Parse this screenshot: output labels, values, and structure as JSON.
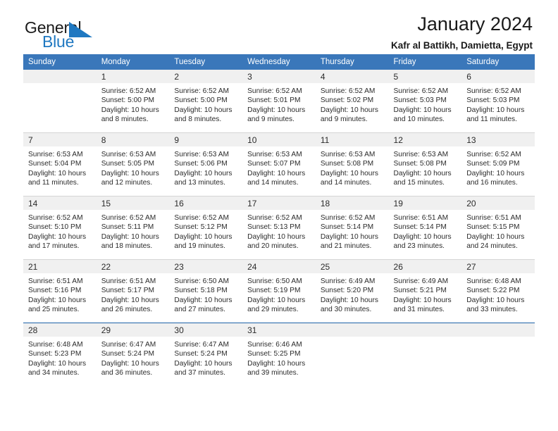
{
  "brand": {
    "name_part1": "General",
    "name_part2": "Blue",
    "accent_color": "#1f78c1"
  },
  "header": {
    "title": "January 2024",
    "subtitle": "Kafr al Battikh, Damietta, Egypt"
  },
  "theme": {
    "header_row_color": "#3a77ba",
    "daynum_band_color": "#f0f0f0",
    "week_divider_color": "#d5d5d5",
    "last_week_divider_color": "#1f63a8"
  },
  "weekday_headers": [
    "Sunday",
    "Monday",
    "Tuesday",
    "Wednesday",
    "Thursday",
    "Friday",
    "Saturday"
  ],
  "labels": {
    "sunrise_prefix": "Sunrise:",
    "sunset_prefix": "Sunset:",
    "daylight_prefix": "Daylight:"
  },
  "weeks": [
    [
      {
        "day": "",
        "sunrise": "",
        "sunset": "",
        "daylight_line1": "",
        "daylight_line2": "",
        "empty": true
      },
      {
        "day": "1",
        "sunrise": "Sunrise: 6:52 AM",
        "sunset": "Sunset: 5:00 PM",
        "daylight_line1": "Daylight: 10 hours",
        "daylight_line2": "and 8 minutes."
      },
      {
        "day": "2",
        "sunrise": "Sunrise: 6:52 AM",
        "sunset": "Sunset: 5:00 PM",
        "daylight_line1": "Daylight: 10 hours",
        "daylight_line2": "and 8 minutes."
      },
      {
        "day": "3",
        "sunrise": "Sunrise: 6:52 AM",
        "sunset": "Sunset: 5:01 PM",
        "daylight_line1": "Daylight: 10 hours",
        "daylight_line2": "and 9 minutes."
      },
      {
        "day": "4",
        "sunrise": "Sunrise: 6:52 AM",
        "sunset": "Sunset: 5:02 PM",
        "daylight_line1": "Daylight: 10 hours",
        "daylight_line2": "and 9 minutes."
      },
      {
        "day": "5",
        "sunrise": "Sunrise: 6:52 AM",
        "sunset": "Sunset: 5:03 PM",
        "daylight_line1": "Daylight: 10 hours",
        "daylight_line2": "and 10 minutes."
      },
      {
        "day": "6",
        "sunrise": "Sunrise: 6:52 AM",
        "sunset": "Sunset: 5:03 PM",
        "daylight_line1": "Daylight: 10 hours",
        "daylight_line2": "and 11 minutes."
      }
    ],
    [
      {
        "day": "7",
        "sunrise": "Sunrise: 6:53 AM",
        "sunset": "Sunset: 5:04 PM",
        "daylight_line1": "Daylight: 10 hours",
        "daylight_line2": "and 11 minutes."
      },
      {
        "day": "8",
        "sunrise": "Sunrise: 6:53 AM",
        "sunset": "Sunset: 5:05 PM",
        "daylight_line1": "Daylight: 10 hours",
        "daylight_line2": "and 12 minutes."
      },
      {
        "day": "9",
        "sunrise": "Sunrise: 6:53 AM",
        "sunset": "Sunset: 5:06 PM",
        "daylight_line1": "Daylight: 10 hours",
        "daylight_line2": "and 13 minutes."
      },
      {
        "day": "10",
        "sunrise": "Sunrise: 6:53 AM",
        "sunset": "Sunset: 5:07 PM",
        "daylight_line1": "Daylight: 10 hours",
        "daylight_line2": "and 14 minutes."
      },
      {
        "day": "11",
        "sunrise": "Sunrise: 6:53 AM",
        "sunset": "Sunset: 5:08 PM",
        "daylight_line1": "Daylight: 10 hours",
        "daylight_line2": "and 14 minutes."
      },
      {
        "day": "12",
        "sunrise": "Sunrise: 6:53 AM",
        "sunset": "Sunset: 5:08 PM",
        "daylight_line1": "Daylight: 10 hours",
        "daylight_line2": "and 15 minutes."
      },
      {
        "day": "13",
        "sunrise": "Sunrise: 6:52 AM",
        "sunset": "Sunset: 5:09 PM",
        "daylight_line1": "Daylight: 10 hours",
        "daylight_line2": "and 16 minutes."
      }
    ],
    [
      {
        "day": "14",
        "sunrise": "Sunrise: 6:52 AM",
        "sunset": "Sunset: 5:10 PM",
        "daylight_line1": "Daylight: 10 hours",
        "daylight_line2": "and 17 minutes."
      },
      {
        "day": "15",
        "sunrise": "Sunrise: 6:52 AM",
        "sunset": "Sunset: 5:11 PM",
        "daylight_line1": "Daylight: 10 hours",
        "daylight_line2": "and 18 minutes."
      },
      {
        "day": "16",
        "sunrise": "Sunrise: 6:52 AM",
        "sunset": "Sunset: 5:12 PM",
        "daylight_line1": "Daylight: 10 hours",
        "daylight_line2": "and 19 minutes."
      },
      {
        "day": "17",
        "sunrise": "Sunrise: 6:52 AM",
        "sunset": "Sunset: 5:13 PM",
        "daylight_line1": "Daylight: 10 hours",
        "daylight_line2": "and 20 minutes."
      },
      {
        "day": "18",
        "sunrise": "Sunrise: 6:52 AM",
        "sunset": "Sunset: 5:14 PM",
        "daylight_line1": "Daylight: 10 hours",
        "daylight_line2": "and 21 minutes."
      },
      {
        "day": "19",
        "sunrise": "Sunrise: 6:51 AM",
        "sunset": "Sunset: 5:14 PM",
        "daylight_line1": "Daylight: 10 hours",
        "daylight_line2": "and 23 minutes."
      },
      {
        "day": "20",
        "sunrise": "Sunrise: 6:51 AM",
        "sunset": "Sunset: 5:15 PM",
        "daylight_line1": "Daylight: 10 hours",
        "daylight_line2": "and 24 minutes."
      }
    ],
    [
      {
        "day": "21",
        "sunrise": "Sunrise: 6:51 AM",
        "sunset": "Sunset: 5:16 PM",
        "daylight_line1": "Daylight: 10 hours",
        "daylight_line2": "and 25 minutes."
      },
      {
        "day": "22",
        "sunrise": "Sunrise: 6:51 AM",
        "sunset": "Sunset: 5:17 PM",
        "daylight_line1": "Daylight: 10 hours",
        "daylight_line2": "and 26 minutes."
      },
      {
        "day": "23",
        "sunrise": "Sunrise: 6:50 AM",
        "sunset": "Sunset: 5:18 PM",
        "daylight_line1": "Daylight: 10 hours",
        "daylight_line2": "and 27 minutes."
      },
      {
        "day": "24",
        "sunrise": "Sunrise: 6:50 AM",
        "sunset": "Sunset: 5:19 PM",
        "daylight_line1": "Daylight: 10 hours",
        "daylight_line2": "and 29 minutes."
      },
      {
        "day": "25",
        "sunrise": "Sunrise: 6:49 AM",
        "sunset": "Sunset: 5:20 PM",
        "daylight_line1": "Daylight: 10 hours",
        "daylight_line2": "and 30 minutes."
      },
      {
        "day": "26",
        "sunrise": "Sunrise: 6:49 AM",
        "sunset": "Sunset: 5:21 PM",
        "daylight_line1": "Daylight: 10 hours",
        "daylight_line2": "and 31 minutes."
      },
      {
        "day": "27",
        "sunrise": "Sunrise: 6:48 AM",
        "sunset": "Sunset: 5:22 PM",
        "daylight_line1": "Daylight: 10 hours",
        "daylight_line2": "and 33 minutes."
      }
    ],
    [
      {
        "day": "28",
        "sunrise": "Sunrise: 6:48 AM",
        "sunset": "Sunset: 5:23 PM",
        "daylight_line1": "Daylight: 10 hours",
        "daylight_line2": "and 34 minutes."
      },
      {
        "day": "29",
        "sunrise": "Sunrise: 6:47 AM",
        "sunset": "Sunset: 5:24 PM",
        "daylight_line1": "Daylight: 10 hours",
        "daylight_line2": "and 36 minutes."
      },
      {
        "day": "30",
        "sunrise": "Sunrise: 6:47 AM",
        "sunset": "Sunset: 5:24 PM",
        "daylight_line1": "Daylight: 10 hours",
        "daylight_line2": "and 37 minutes."
      },
      {
        "day": "31",
        "sunrise": "Sunrise: 6:46 AM",
        "sunset": "Sunset: 5:25 PM",
        "daylight_line1": "Daylight: 10 hours",
        "daylight_line2": "and 39 minutes."
      },
      {
        "day": "",
        "sunrise": "",
        "sunset": "",
        "daylight_line1": "",
        "daylight_line2": "",
        "empty": true
      },
      {
        "day": "",
        "sunrise": "",
        "sunset": "",
        "daylight_line1": "",
        "daylight_line2": "",
        "empty": true
      },
      {
        "day": "",
        "sunrise": "",
        "sunset": "",
        "daylight_line1": "",
        "daylight_line2": "",
        "empty": true
      }
    ]
  ]
}
